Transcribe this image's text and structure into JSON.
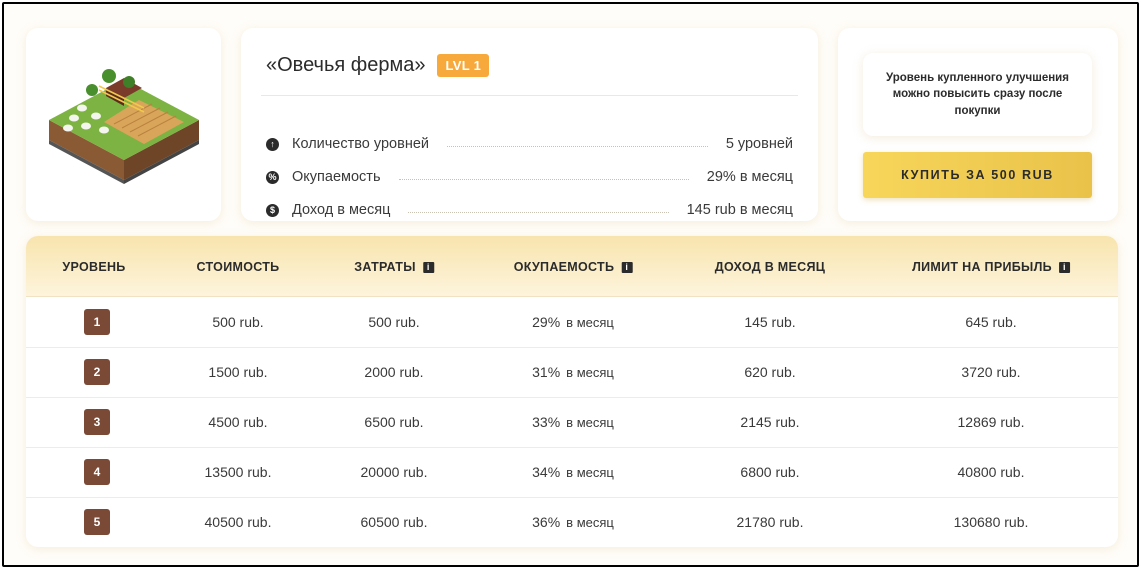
{
  "farm": {
    "title": "«Овечья ферма»",
    "level_badge": "LVL 1",
    "image_alt": "isometric-sheep-farm"
  },
  "stats": [
    {
      "icon": "arrow-up-circle-icon",
      "label": "Количество уровней",
      "value": "5 уровней"
    },
    {
      "icon": "percent-circle-icon",
      "label": "Окупаемость",
      "value": "29% в месяц"
    },
    {
      "icon": "dollar-circle-icon",
      "label": "Доход в месяц",
      "value": "145 rub в месяц"
    }
  ],
  "buy": {
    "note": "Уровень купленного улучшения можно повысить сразу после покупки",
    "button_label": "КУПИТЬ ЗА 500 RUB"
  },
  "table": {
    "headers": [
      "УРОВЕНЬ",
      "СТОИМОСТЬ",
      "ЗАТРАТЫ",
      "ОКУПАЕМОСТЬ",
      "ДОХОД В МЕСЯЦ",
      "ЛИМИТ НА ПРИБЫЛЬ"
    ],
    "payback_suffix": "в месяц",
    "rows": [
      {
        "level": "1",
        "cost": "500 rub.",
        "expenses": "500 rub.",
        "payback": "29%",
        "income": "145 rub.",
        "limit": "645 rub."
      },
      {
        "level": "2",
        "cost": "1500 rub.",
        "expenses": "2000 rub.",
        "payback": "31%",
        "income": "620 rub.",
        "limit": "3720 rub."
      },
      {
        "level": "3",
        "cost": "4500 rub.",
        "expenses": "6500 rub.",
        "payback": "33%",
        "income": "2145 rub.",
        "limit": "12869 rub."
      },
      {
        "level": "4",
        "cost": "13500 rub.",
        "expenses": "20000 rub.",
        "payback": "34%",
        "income": "6800 rub.",
        "limit": "40800 rub."
      },
      {
        "level": "5",
        "cost": "40500 rub.",
        "expenses": "60500 rub.",
        "payback": "36%",
        "income": "21780 rub.",
        "limit": "130680 rub."
      }
    ]
  },
  "colors": {
    "accent_orange": "#f7a93b",
    "button_yellow": "#f7d65a",
    "level_brown": "#7a4a36",
    "header_cream": "#f8e4ad"
  }
}
